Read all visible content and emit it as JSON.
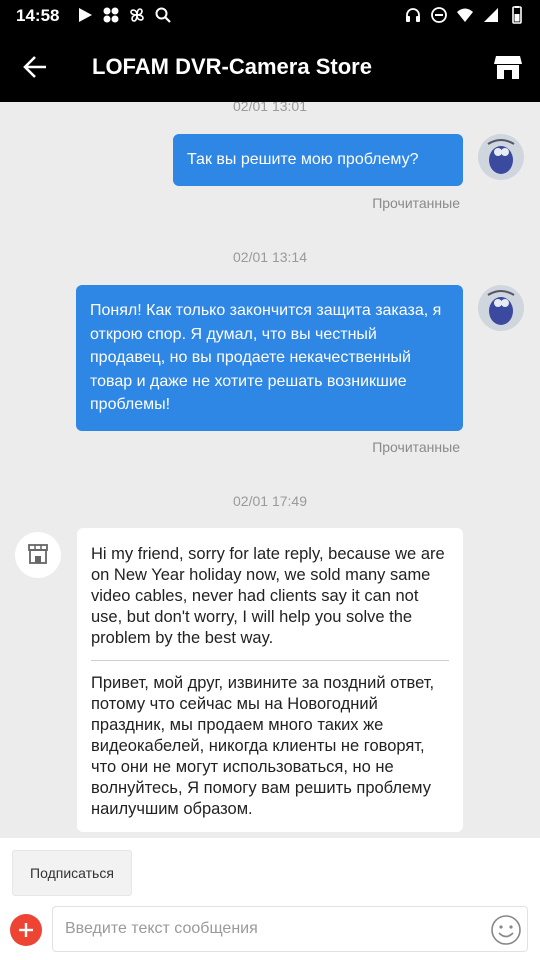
{
  "status": {
    "time": "14:58"
  },
  "header": {
    "title": "LOFAM DVR-Camera Store"
  },
  "messages": [
    {
      "timestamp": "02/01 13:01",
      "from": "user",
      "text": "Так вы решите мою проблему?",
      "status": "Прочитанные"
    },
    {
      "timestamp": "02/01 13:14",
      "from": "user",
      "text": "Понял! Как только закончится защита заказа, я открою спор. Я думал, что вы честный продавец, но вы продаете некачественный товар и даже не хотите решать возникшие проблемы!",
      "status": "Прочитанные"
    },
    {
      "timestamp": "02/01 17:49",
      "from": "store",
      "text_en": "Hi my friend, sorry for late reply, because we are on New Year holiday now, we sold many same video cables, never had clients say it can not use, but don't worry, I will help you solve the problem by the best way.",
      "text_ru": "Привет, мой друг, извините за поздний ответ, потому что сейчас мы на Новогодний праздник, мы продаем много таких же видеокабелей, никогда клиенты не говорят, что они не могут использоваться, но не волнуйтесь, Я помогу вам решить проблему наилучшим образом."
    }
  ],
  "footer": {
    "subscribe_label": "Подписаться",
    "input_placeholder": "Введите текст сообщения"
  },
  "colors": {
    "bubble_out": "#2e86e5",
    "accent_plus": "#ee4433",
    "header_bg": "#000000"
  }
}
